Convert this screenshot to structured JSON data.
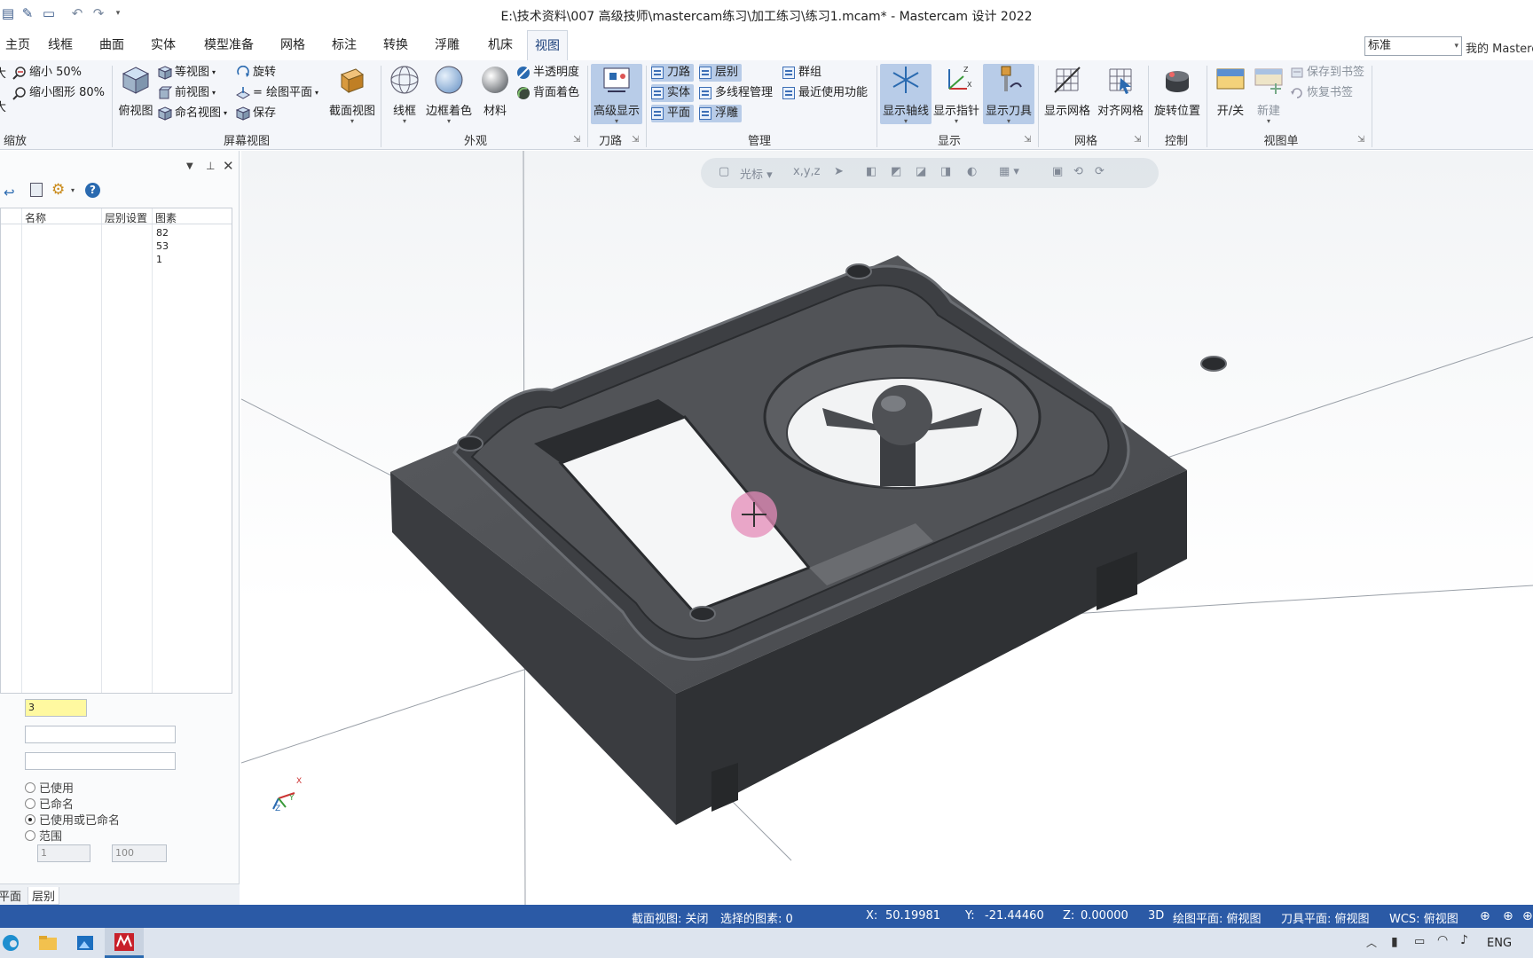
{
  "window": {
    "title": "E:\\技术资料\\007 高级技师\\mastercam练习\\加工练习\\练习1.mcam* - Mastercam 设计 2022"
  },
  "tabs": [
    "主页",
    "线框",
    "曲面",
    "实体",
    "模型准备",
    "网格",
    "标注",
    "转换",
    "浮雕",
    "机床",
    "视图"
  ],
  "active_tab": "视图",
  "header_right": {
    "style_select": "标准",
    "my_master": "我的 Mastercam"
  },
  "ribbon": {
    "zoom": {
      "label": "缩放",
      "items": [
        "缩小 50%",
        "缩小图形 80%"
      ],
      "big_partial": "大"
    },
    "screen_view": {
      "label": "屏幕视图",
      "top_view": "俯视图",
      "items": [
        "等视图",
        "前视图",
        "命名视图",
        "旋转",
        "= 绘图平面",
        "保存"
      ],
      "section_view": "截面视图"
    },
    "appearance": {
      "label": "外观",
      "wireframe": "线框",
      "edge_shade": "边框着色",
      "material": "材料",
      "translucency": "半透明度",
      "back_shade": "背面着色"
    },
    "toolpath": {
      "label": "刀路",
      "advanced_display": "高级显示"
    },
    "manage": {
      "label": "管理",
      "items": [
        "刀路",
        "层别",
        "群组",
        "实体",
        "多线程管理",
        "最近使用功能",
        "平面",
        "浮雕"
      ]
    },
    "display": {
      "label": "显示",
      "items": [
        "显示轴线",
        "显示指针",
        "显示刀具"
      ]
    },
    "grid": {
      "label": "网格",
      "items": [
        "显示网格",
        "对齐网格"
      ]
    },
    "control": {
      "label": "控制",
      "items": [
        "旋转位置"
      ]
    },
    "viewsheet": {
      "label": "视图单",
      "toggle": "开/关",
      "new": "新建",
      "save_bookmark": "保存到书签",
      "restore_bookmark": "恢复书签"
    }
  },
  "left_panel": {
    "columns": [
      "名称",
      "层别设置",
      "图素"
    ],
    "rows": [
      {
        "count": "82"
      },
      {
        "count": "53"
      },
      {
        "count": "1"
      }
    ],
    "number_field": "3",
    "radios": [
      {
        "label": "已使用",
        "checked": false
      },
      {
        "label": "已命名",
        "checked": false
      },
      {
        "label": "已使用或已命名",
        "checked": true
      },
      {
        "label": "范围",
        "checked": false
      }
    ],
    "range_from": "1",
    "range_to": "100",
    "bottom_tabs": [
      "平面",
      "层别"
    ]
  },
  "viewport": {
    "floating_toolbar_label": "光标",
    "axis_labels": {
      "x": "X",
      "y": "Y",
      "z": "Z"
    }
  },
  "statusbar": {
    "section_view": "截面视图: 关闭",
    "selected": "选择的图素: 0",
    "x_label": "X:",
    "x_value": "50.19981",
    "y_label": "Y:",
    "y_value": "-21.44460",
    "z_label": "Z:",
    "z_value": "0.00000",
    "mode": "3D",
    "cplane": "绘图平面: 俯视图",
    "tplane": "刀具平面: 俯视图",
    "wcs": "WCS: 俯视图"
  },
  "taskbar": {
    "lang": "ENG"
  },
  "colors": {
    "status_bar": "#2b5aa6",
    "ribbon_bg": "#f4f6fa",
    "highlight": "#b8cce8",
    "part": "#4a4c4f"
  }
}
